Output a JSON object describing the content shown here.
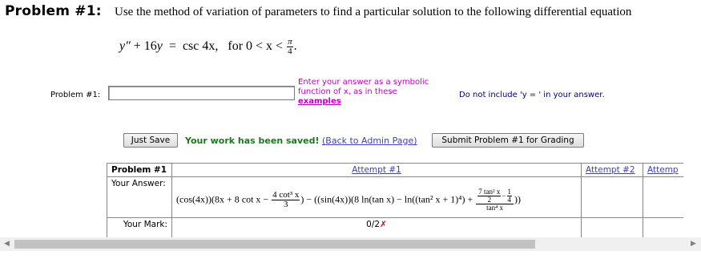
{
  "problem": {
    "heading": "Problem #1:",
    "text": "Use the method of variation of parameters to find a particular solution to the following differential equation",
    "equation": {
      "lhs_y2": "y″",
      "plus": "+ 16",
      "y": "y",
      "equals": "=",
      "rhs": "csc 4x,",
      "for": "for 0 < x <",
      "pi": "π",
      "four": "4",
      "dot": "."
    }
  },
  "answer_row": {
    "label": "Problem #1:",
    "input_value": "",
    "hint_line1": "Enter your answer as a symbolic",
    "hint_line2": "function of x, as in these",
    "hint_link": "examples",
    "no_include": "Do not include 'y = ' in your answer."
  },
  "actions": {
    "just_save": "Just Save",
    "saved_message": "Your work has been saved!",
    "back_link": "(Back to Admin Page)",
    "submit": "Submit Problem #1 for Grading"
  },
  "results_table": {
    "header_problem": "Problem #1",
    "header_attempt1": "Attempt #1",
    "header_attempt2": "Attempt #2",
    "header_attempt3": "Attemp",
    "row_answer_label": "Your Answer:",
    "answer_part1": "(cos(4x))(8x + 8 cot x −",
    "answer_frac1_num": "4 cot³ x",
    "answer_frac1_den": "3",
    "answer_part2": ") − ((sin(4x))(8 ln(tan x) − ln((tan² x + 1)⁴) +",
    "answer_frac2_num_a": "7 tan² x",
    "answer_frac2_den_a": "2",
    "answer_frac2_minus": "−",
    "answer_frac2_num_b": "1",
    "answer_frac2_den_b": "4",
    "answer_frac2_den": "tan⁴ x",
    "answer_part3": "))",
    "row_mark_label": "Your Mark:",
    "mark_value": "0/2",
    "mark_x": "✗"
  },
  "colors": {
    "hint": "#c000c0",
    "saved": "#1a7a1a",
    "link": "#4040c0",
    "mark_x": "#e00000"
  }
}
